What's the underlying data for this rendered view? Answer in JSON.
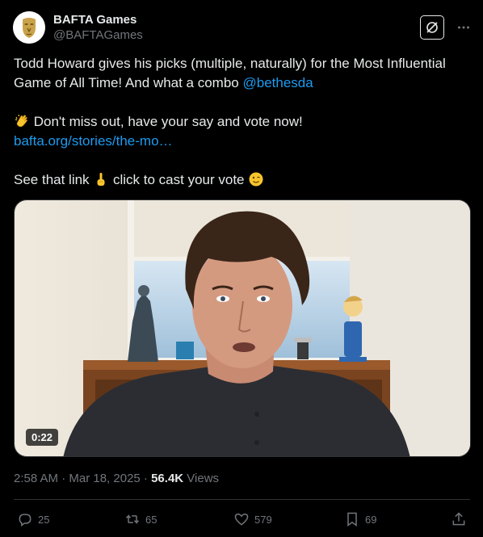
{
  "account": {
    "display_name": "BAFTA Games",
    "handle": "@BAFTAGames"
  },
  "post": {
    "line1": "Todd Howard gives his picks (multiple, naturally) for the Most Influential Game of All Time! And what a combo ",
    "mention": "@bethesda",
    "line2": " Don't miss out, have your say and vote now!",
    "link": "bafta.org/stories/the-mo…",
    "line3_a": "See that link ",
    "line3_b": " click to cast your vote "
  },
  "media": {
    "duration": "0:22"
  },
  "meta": {
    "time": "2:58 AM · Mar 18, 2025 · ",
    "views_count": "56.4K",
    "views_label": " Views"
  },
  "actions": {
    "replies": "25",
    "reposts": "65",
    "likes": "579",
    "bookmarks": "69"
  },
  "icons": {
    "avatar": "bafta-mask-logo",
    "grok": "grok-icon",
    "more": "more-icon",
    "clap": "clapping-hands-emoji",
    "point": "pointing-up-emoji",
    "wink": "winking-face-emoji"
  },
  "colors": {
    "link": "#1d9bf0",
    "secondary_text": "#71767b",
    "text": "#e7e9ea",
    "background": "#000000"
  }
}
